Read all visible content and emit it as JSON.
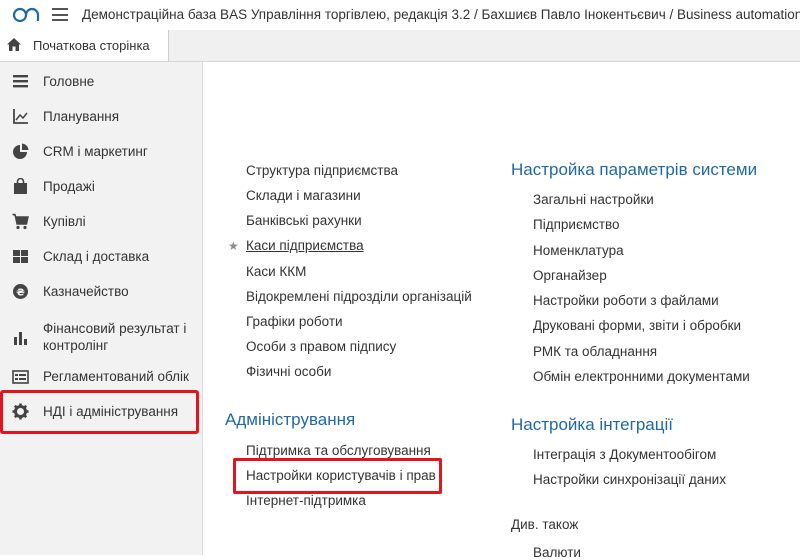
{
  "header": {
    "title": "Демонстраційна база BAS Управління торгівлею, редакція 3.2 / Бахшиєв Павло Інокентьєвич / Business automation s"
  },
  "tabs": [
    {
      "label": "Початкова сторінка",
      "icon": "home-icon"
    }
  ],
  "sidebar": {
    "items": [
      {
        "label": "Головне",
        "icon": "list-icon"
      },
      {
        "label": "Планування",
        "icon": "chart-axis-icon"
      },
      {
        "label": "CRM і маркетинг",
        "icon": "pie-chart-icon"
      },
      {
        "label": "Продажі",
        "icon": "shopping-bag-icon"
      },
      {
        "label": "Купівлі",
        "icon": "cart-icon"
      },
      {
        "label": "Склад і доставка",
        "icon": "grid-icon"
      },
      {
        "label": "Казначейство",
        "icon": "coin-icon"
      },
      {
        "label": "Фінансовий результат і контролінг",
        "icon": "bar-chart-icon"
      },
      {
        "label": "Регламентований облік",
        "icon": "ledger-icon"
      },
      {
        "label": "НДІ і адміністрування",
        "icon": "gear-icon"
      }
    ]
  },
  "main": {
    "left_links": [
      "Структура підприємства",
      "Склади і магазини",
      "Банківські рахунки",
      "Каси підприємства",
      "Каси ККМ",
      "Відокремлені підрозділи організацій",
      "Графіки роботи",
      "Особи з правом підпису",
      "Фізичні особи"
    ],
    "admin_title": "Адміністрування",
    "admin_links": [
      "Підтримка та обслуговування",
      "Настройки користувачів і прав",
      "Інтернет-підтримка"
    ],
    "system_title": "Настройка параметрів системи",
    "system_links": [
      "Загальні настройки",
      "Підприємство",
      "Номенклатура",
      "Органайзер",
      "Настройки роботи з файлами",
      "Друковані форми, звіти і обробки",
      "РМК та обладнання",
      "Обмін електронними документами"
    ],
    "integration_title": "Настройка інтеграції",
    "integration_links": [
      "Інтеграція з Документообігом",
      "Настройки синхронізації даних"
    ],
    "see_also_title": "Див. також",
    "see_also_links": [
      "Валюти"
    ]
  },
  "colors": {
    "accent": "#1f69a6",
    "highlight": "#e3141b",
    "sidebar_bg": "#f2f2f2"
  }
}
